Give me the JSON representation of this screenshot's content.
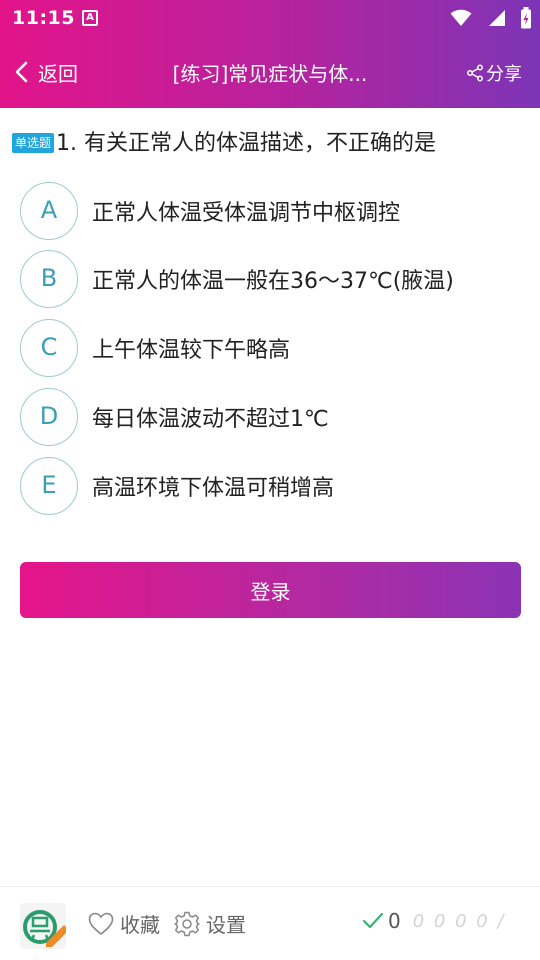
{
  "status_bar": {
    "time": "11:15",
    "app_icon_letter": "A"
  },
  "navbar": {
    "back_label": "返回",
    "title": "[练习]常见症状与体...",
    "share_label": "分享"
  },
  "question": {
    "type_badge": "单选题",
    "text": "1. 有关正常人的体温描述，不正确的是"
  },
  "options": [
    {
      "letter": "A",
      "text": "正常人体温受体温调节中枢调控"
    },
    {
      "letter": "B",
      "text": "正常人的体温一般在36～37℃(腋温)"
    },
    {
      "letter": "C",
      "text": "上午体温较下午略高"
    },
    {
      "letter": "D",
      "text": "每日体温波动不超过1℃"
    },
    {
      "letter": "E",
      "text": "高温环境下体温可稍增高"
    }
  ],
  "login_button": "登录",
  "bottom_bar": {
    "collect_label": "收藏",
    "settings_label": "设置",
    "correct_count": "0",
    "faded_text": "0 0 0 0 /"
  },
  "colors": {
    "header_start": "#e3148a",
    "header_end": "#7c35b6",
    "badge": "#22a4dc",
    "option_border": "#9fcad3",
    "option_letter": "#3a9fb3",
    "check": "#3cb371"
  }
}
